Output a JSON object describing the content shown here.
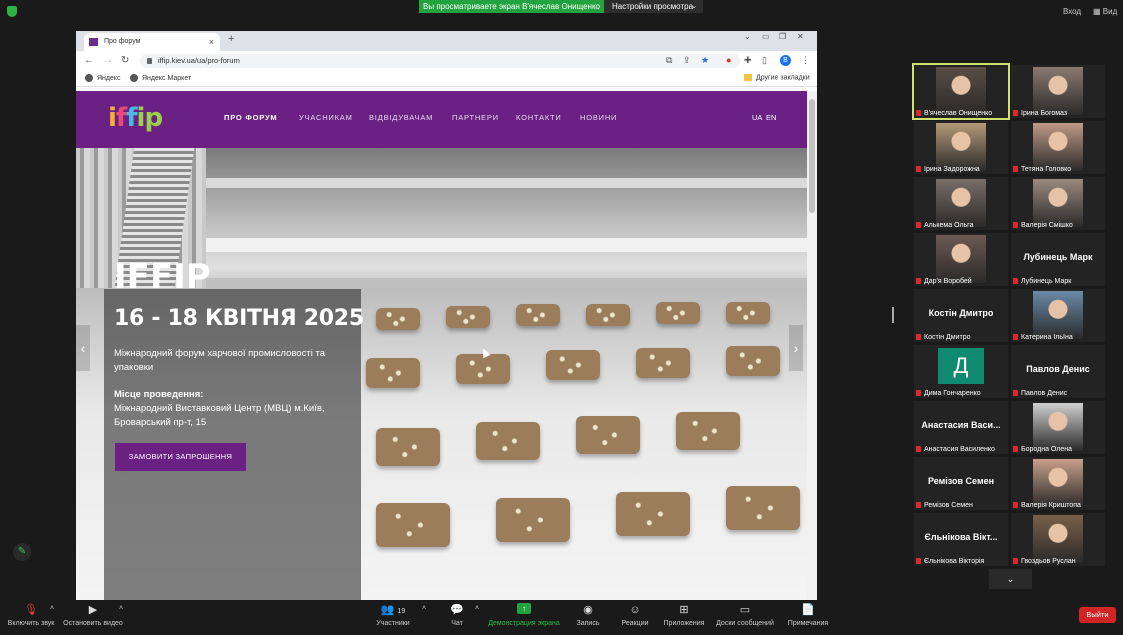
{
  "zoom_top": {
    "share_banner": "Вы просматриваете экран В'ячеслав Онищенко",
    "view_options": "Настройки просмотра",
    "enter": "Вход",
    "view": "Вид"
  },
  "browser": {
    "tab_title": "Про форум",
    "url": "iffip.kiev.ua/ua/pro-forum",
    "avatar_letter": "B",
    "bookmarks": [
      "Яндекс",
      "Яндекс Маркет"
    ],
    "other_bookmarks": "Другие закладки"
  },
  "site": {
    "logo": [
      "i",
      "f",
      "f",
      "ip"
    ],
    "menu": [
      "ПРО ФОРУМ",
      "УЧАСНИКАМ",
      "ВІДВІДУВАЧАМ",
      "ПАРТНЕРИ",
      "КОНТАКТИ",
      "НОВИНИ"
    ],
    "lang": [
      "UA",
      "EN"
    ],
    "hero": {
      "title": "IFFIP",
      "date": "16 - 18 КВІТНЯ 2025",
      "description": "Міжнародний форум харчової промисловості та упаковки",
      "location_heading": "Місце проведення:",
      "location": "Міжнародний Виставковий Центр (МВЦ) м.Київ, Броварський пр-т, 15",
      "button": "ЗАМОВИТИ ЗАПРОШЕННЯ"
    }
  },
  "participants": [
    {
      "name": "В'ячеслав Онищенко",
      "type": "video",
      "color": "#5a4d44"
    },
    {
      "name": "Ірина Богомаз",
      "type": "video",
      "color": "#8a7a70"
    },
    {
      "name": "Ірина Задорожна",
      "type": "video",
      "color": "#b49a78"
    },
    {
      "name": "Тетяна Головко",
      "type": "video",
      "color": "#c09a86"
    },
    {
      "name": "Алькема Ольга",
      "type": "video",
      "color": "#7a6e68"
    },
    {
      "name": "Валерія Смішко",
      "type": "video",
      "color": "#9a8a7e"
    },
    {
      "name": "Дар'я Воробей",
      "type": "video",
      "color": "#6d5a52"
    },
    {
      "name": "Лубинець Марк",
      "type": "name",
      "display": "Лубинець Марк"
    },
    {
      "name": "Костін Дмитро",
      "type": "name",
      "display": "Костін Дмитро"
    },
    {
      "name": "Катерина Ільїна",
      "type": "video",
      "color": "#6a8aa8"
    },
    {
      "name": "Дима Гончаренко",
      "type": "letter",
      "display": "Д"
    },
    {
      "name": "Павлов Денис",
      "type": "name",
      "display": "Павлов Денис"
    },
    {
      "name": "Анастасия Василенко",
      "type": "name",
      "display": "Анастасия Васи..."
    },
    {
      "name": "Бородна Олена",
      "type": "video",
      "color": "#d0d0d0"
    },
    {
      "name": "Ремізов Семен",
      "type": "name",
      "display": "Ремізов Семен"
    },
    {
      "name": "Валерія Криштопа",
      "type": "video",
      "color": "#c9a08a"
    },
    {
      "name": "Єльнікова Вікторія",
      "type": "name",
      "display": "Єльнікова Вікт..."
    },
    {
      "name": "Гвоздьов Руслан",
      "type": "video",
      "color": "#7a6048"
    }
  ],
  "toolbar": {
    "unmute": "Включить звук",
    "stop_video": "Остановить видео",
    "participants": "Участники",
    "participants_count": "19",
    "chat": "Чат",
    "share": "Демонстрация экрана",
    "record": "Запись",
    "reactions": "Реакции",
    "apps": "Приложения",
    "whiteboard": "Доски сообщений",
    "notes": "Примечания",
    "leave": "Выйти"
  },
  "colors": {
    "brand_purple": "#6b2183",
    "zoom_green": "#23a33f",
    "leave_red": "#d02525"
  }
}
